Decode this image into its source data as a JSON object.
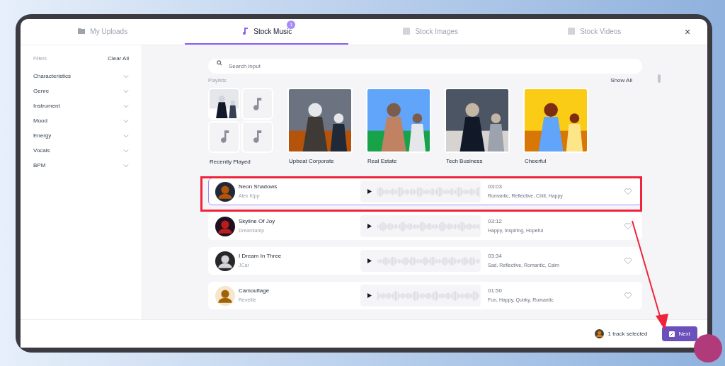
{
  "tabs": [
    {
      "label": "My Uploads",
      "selected": false,
      "kind": "uploads"
    },
    {
      "label": "Stock Music",
      "selected": true,
      "kind": "music",
      "badge": "1"
    },
    {
      "label": "Stock Images",
      "selected": false,
      "kind": "images"
    },
    {
      "label": "Stock Videos",
      "selected": false,
      "kind": "videos"
    }
  ],
  "close": "×",
  "filters": {
    "title": "Filters",
    "clear": "Clear All",
    "items": [
      {
        "label": "Characteristics",
        "expanded": false
      },
      {
        "label": "Genre",
        "expanded": false
      },
      {
        "label": "Instrument",
        "expanded": false
      },
      {
        "label": "Mood",
        "expanded": false
      },
      {
        "label": "Energy",
        "expanded": false
      },
      {
        "label": "Vocals",
        "expanded": false
      },
      {
        "label": "BPM",
        "expanded": false
      }
    ]
  },
  "search": {
    "placeholder": "Search input"
  },
  "playlists": {
    "title": "Playlists",
    "show_all": "Show All",
    "items": [
      {
        "label": "Recently Played",
        "kind": "collage"
      },
      {
        "label": "Upbeat Corporate",
        "kind": "picture"
      },
      {
        "label": "Real Estate",
        "kind": "picture"
      },
      {
        "label": "Tech Business",
        "kind": "picture"
      },
      {
        "label": "Cheerful",
        "kind": "picture"
      }
    ]
  },
  "tracks": [
    {
      "title": "Neon Shadows",
      "artist": "Alex Kipp",
      "duration": "03:03",
      "tags": "Romantic, Reflective, Chill, Happy",
      "selected": true,
      "liked": false
    },
    {
      "title": "Skyline Of Joy",
      "artist": "Dreamlamp",
      "duration": "03:12",
      "tags": "Happy, Inspiring, Hopeful",
      "selected": false,
      "liked": false
    },
    {
      "title": "I Dream In Three",
      "artist": "JCar",
      "duration": "03:34",
      "tags": "Sad, Reflective, Romantic, Calm",
      "selected": false,
      "liked": false
    },
    {
      "title": "Camouflage",
      "artist": "Reveille",
      "duration": "01:50",
      "tags": "Fun, Happy, Quirky, Romantic",
      "selected": false,
      "liked": false
    }
  ],
  "footer": {
    "status": "1 track selected",
    "next": "Next"
  }
}
